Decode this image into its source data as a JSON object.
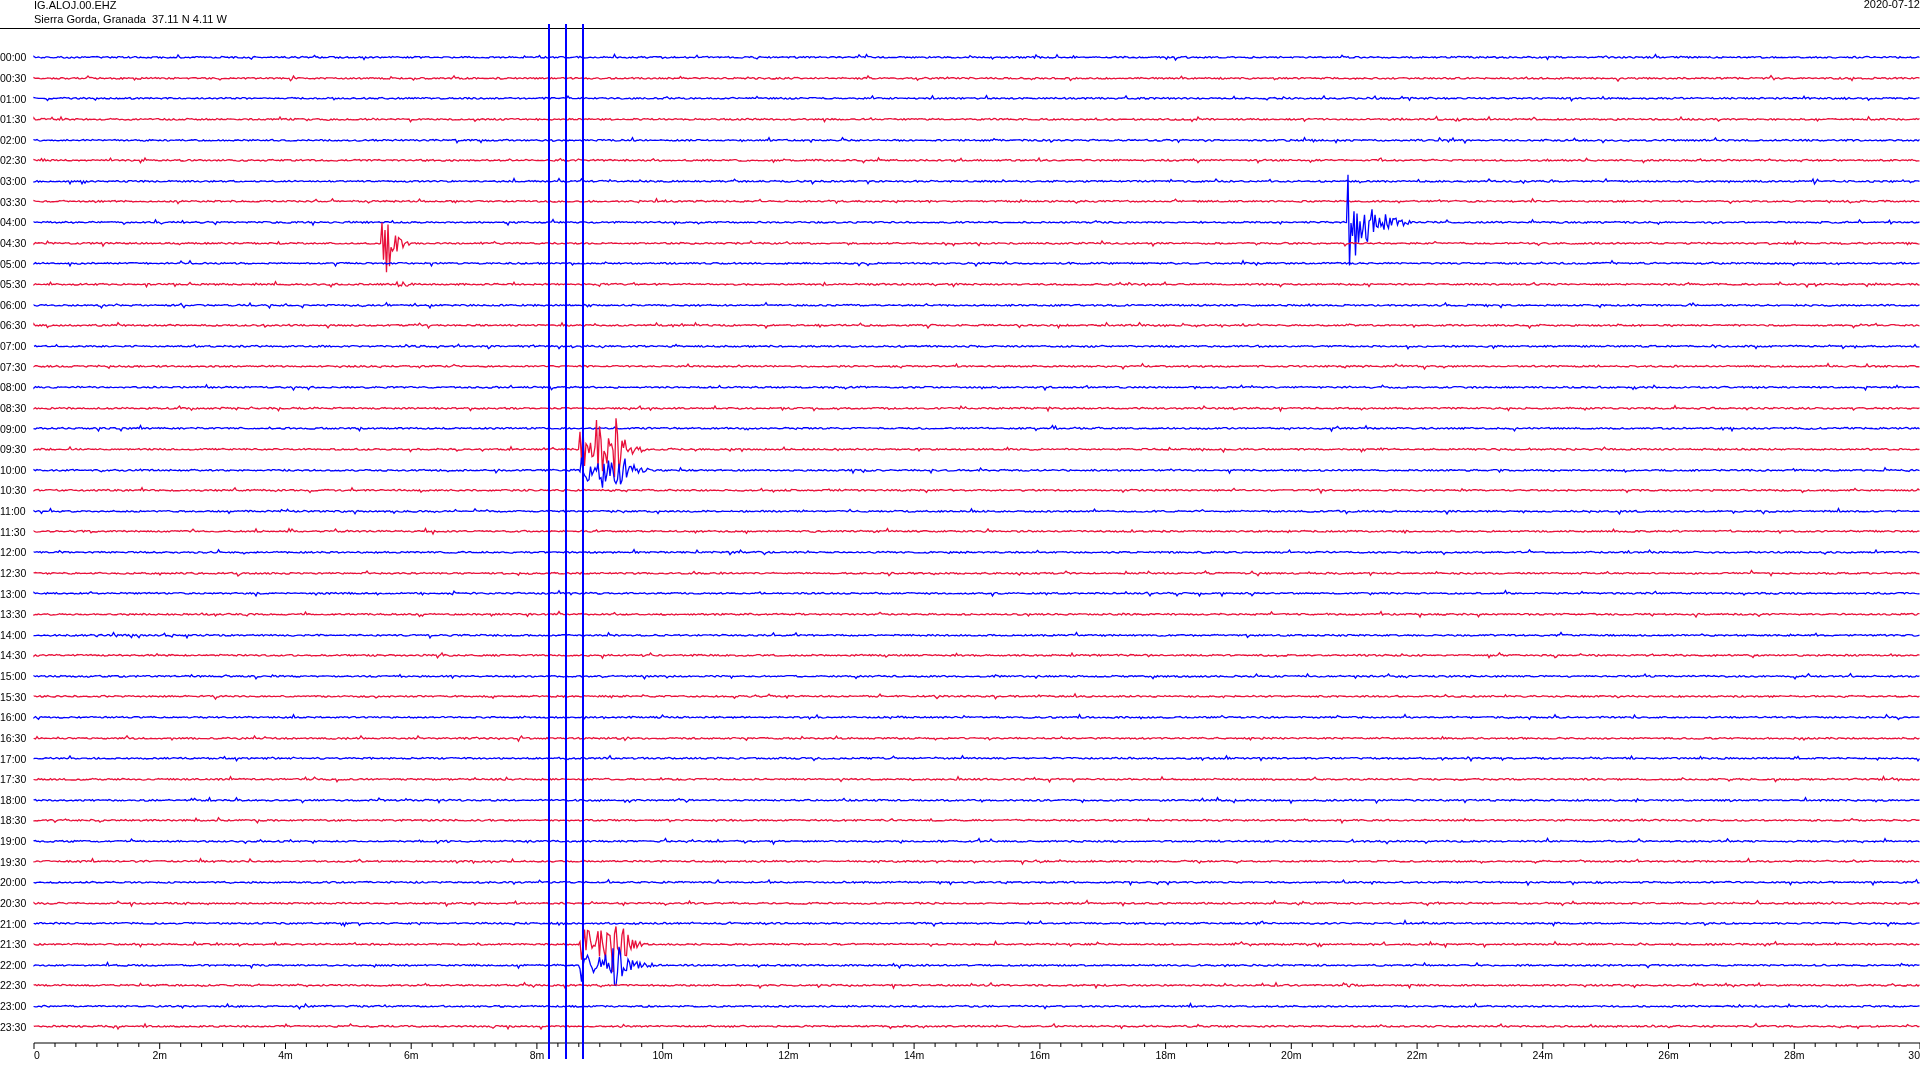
{
  "header": {
    "station": "IG.ALOJ.00.EHZ",
    "location": "Sierra Gorda, Granada  37.11 N 4.11 W",
    "date": "2020-07-12"
  },
  "rows": [
    {
      "time": "00:00",
      "color": "#0000ff"
    },
    {
      "time": "00:30",
      "color": "#e8103a"
    },
    {
      "time": "01:00",
      "color": "#0000ff"
    },
    {
      "time": "01:30",
      "color": "#e8103a"
    },
    {
      "time": "02:00",
      "color": "#0000ff"
    },
    {
      "time": "02:30",
      "color": "#e8103a"
    },
    {
      "time": "03:00",
      "color": "#0000ff"
    },
    {
      "time": "03:30",
      "color": "#e8103a"
    },
    {
      "time": "04:00",
      "color": "#0000ff"
    },
    {
      "time": "04:30",
      "color": "#e8103a"
    },
    {
      "time": "05:00",
      "color": "#0000ff"
    },
    {
      "time": "05:30",
      "color": "#e8103a"
    },
    {
      "time": "06:00",
      "color": "#0000ff"
    },
    {
      "time": "06:30",
      "color": "#e8103a"
    },
    {
      "time": "07:00",
      "color": "#0000ff"
    },
    {
      "time": "07:30",
      "color": "#e8103a"
    },
    {
      "time": "08:00",
      "color": "#0000ff"
    },
    {
      "time": "08:30",
      "color": "#e8103a"
    },
    {
      "time": "09:00",
      "color": "#0000ff"
    },
    {
      "time": "09:30",
      "color": "#e8103a"
    },
    {
      "time": "10:00",
      "color": "#0000ff"
    },
    {
      "time": "10:30",
      "color": "#e8103a"
    },
    {
      "time": "11:00",
      "color": "#0000ff"
    },
    {
      "time": "11:30",
      "color": "#e8103a"
    },
    {
      "time": "12:00",
      "color": "#0000ff"
    },
    {
      "time": "12:30",
      "color": "#e8103a"
    },
    {
      "time": "13:00",
      "color": "#0000ff"
    },
    {
      "time": "13:30",
      "color": "#e8103a"
    },
    {
      "time": "14:00",
      "color": "#0000ff"
    },
    {
      "time": "14:30",
      "color": "#e8103a"
    },
    {
      "time": "15:00",
      "color": "#0000ff"
    },
    {
      "time": "15:30",
      "color": "#e8103a"
    },
    {
      "time": "16:00",
      "color": "#0000ff"
    },
    {
      "time": "16:30",
      "color": "#e8103a"
    },
    {
      "time": "17:00",
      "color": "#0000ff"
    },
    {
      "time": "17:30",
      "color": "#e8103a"
    },
    {
      "time": "18:00",
      "color": "#0000ff"
    },
    {
      "time": "18:30",
      "color": "#e8103a"
    },
    {
      "time": "19:00",
      "color": "#0000ff"
    },
    {
      "time": "19:30",
      "color": "#e8103a"
    },
    {
      "time": "20:00",
      "color": "#0000ff"
    },
    {
      "time": "20:30",
      "color": "#e8103a"
    },
    {
      "time": "21:00",
      "color": "#0000ff"
    },
    {
      "time": "21:30",
      "color": "#e8103a"
    },
    {
      "time": "22:00",
      "color": "#0000ff"
    },
    {
      "time": "22:30",
      "color": "#e8103a"
    },
    {
      "time": "23:00",
      "color": "#0000ff"
    },
    {
      "time": "23:30",
      "color": "#e8103a"
    }
  ],
  "x_axis": {
    "ticks": [
      "0",
      "2m",
      "4m",
      "6m",
      "8m",
      "10m",
      "12m",
      "14m",
      "16m",
      "18m",
      "20m",
      "22m",
      "24m",
      "26m",
      "28m",
      "30"
    ]
  }
}
